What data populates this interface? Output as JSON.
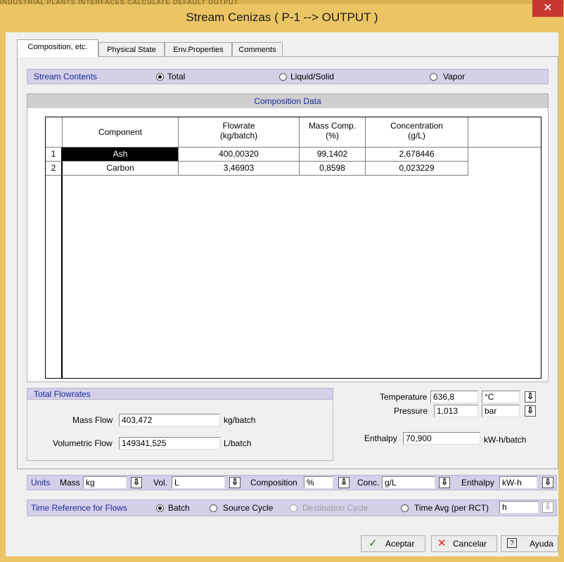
{
  "window": {
    "title": "Stream Cenizas ( P-1 --> OUTPUT )",
    "close_icon": "close-icon",
    "behind_text": "INDUSTRIAL   PLANTS   INTERFACES   CALCULATE   DEFAULT   OUTPUT"
  },
  "tabs": [
    "Composition, etc.",
    "Physical State",
    "Env.Properties",
    "Comments"
  ],
  "stream_contents": {
    "label": "Stream Contents",
    "options": [
      "Total",
      "Liquid/Solid",
      "Vapor"
    ],
    "selected": "Total"
  },
  "composition": {
    "header": "Composition Data",
    "columns": [
      "Component",
      "Flowrate\n(kg/batch)",
      "Mass Comp.\n(%)",
      "Concentration\n(g/L)"
    ],
    "col_lines": [
      [
        "Component"
      ],
      [
        "Flowrate",
        "(kg/batch)"
      ],
      [
        "Mass Comp.",
        "(%)"
      ],
      [
        "Concentration",
        "(g/L)"
      ]
    ],
    "rows": [
      {
        "num": "1",
        "component": "Ash",
        "flowrate": "400,00320",
        "mass_comp": "99,1402",
        "concentration": "2,678446",
        "selected": true
      },
      {
        "num": "2",
        "component": "Carbon",
        "flowrate": "3,46903",
        "mass_comp": "0,8598",
        "concentration": "0,023229",
        "selected": false
      }
    ]
  },
  "total_flowrates": {
    "label": "Total Flowrates",
    "mass_flow_label": "Mass Flow",
    "mass_flow_value": "403,472",
    "mass_flow_unit": "kg/batch",
    "vol_flow_label": "Volumetric Flow",
    "vol_flow_value": "149341,525",
    "vol_flow_unit": "L/batch"
  },
  "state": {
    "temp_label": "Temperature",
    "temp_value": "636,8",
    "temp_unit": "°C",
    "pressure_label": "Pressure",
    "pressure_value": "1,013",
    "pressure_unit": "bar",
    "enthalpy_label": "Enthalpy",
    "enthalpy_value": "70,900",
    "enthalpy_unit": "kW-h/batch"
  },
  "units": {
    "label": "Units",
    "mass_label": "Mass",
    "mass_value": "kg",
    "vol_label": "Vol.",
    "vol_value": "L",
    "comp_label": "Composition",
    "comp_value": "%",
    "conc_label": "Conc.",
    "conc_value": "g/L",
    "enth_label": "Enthalpy",
    "enth_value": "kW-h"
  },
  "time_ref": {
    "label": "Time Reference for Flows",
    "options": [
      "Batch",
      "Source Cycle",
      "Destination Cycle",
      "Time Avg (per RCT)"
    ],
    "selected": "Batch",
    "time_unit": "h"
  },
  "buttons": {
    "ok": "Aceptar",
    "cancel": "Cancelar",
    "help": "Ayuda"
  },
  "colors": {
    "title_bar": "#ebc564",
    "accent_text": "#1b2a9e",
    "close": "#c7372f"
  }
}
